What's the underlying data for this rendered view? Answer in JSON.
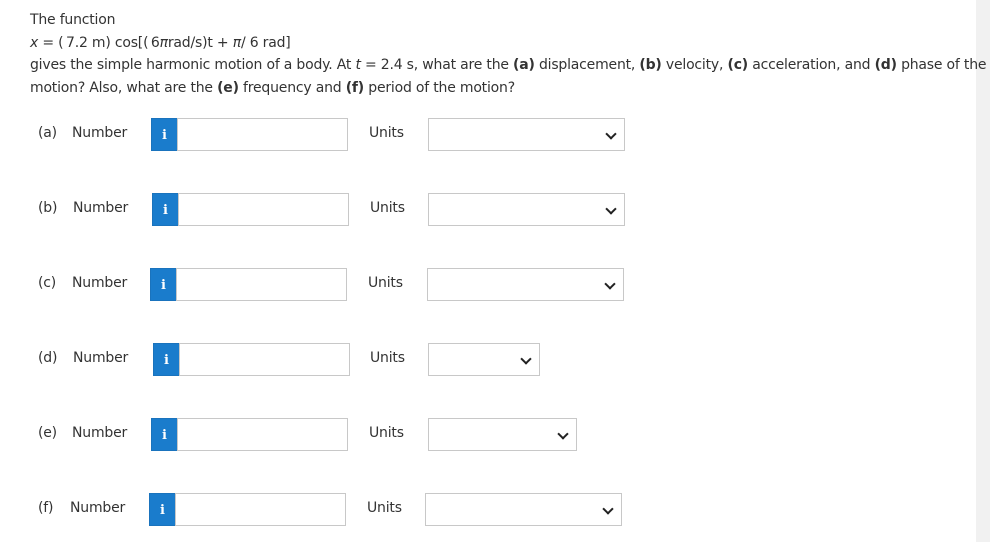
{
  "question": {
    "intro": "The function",
    "equation": {
      "var": "x",
      "eq": " = ( 7.2 m) cos[( 6",
      "pi1": "π",
      "unit": "rad/s)t + ",
      "pi2": "π",
      "tail": "/ 6 rad]"
    },
    "body": {
      "s1": "gives the simple harmonic motion of a body. At ",
      "t_var": "t",
      "s2": " = 2.4 s, what are the ",
      "a": "(a)",
      "a_text": " displacement, ",
      "b": "(b)",
      "b_text": " velocity, ",
      "c": "(c)",
      "c_text": " acceleration, and ",
      "d": "(d)",
      "d_text": " phase of the",
      "line2_start": "motion? Also, what are the ",
      "e": "(e)",
      "e_text": " frequency and ",
      "f": "(f)",
      "f_text": " period of the motion?"
    }
  },
  "answer_rows": [
    {
      "part": "(a)",
      "number_label": "Number",
      "info_icon": "i",
      "value": "",
      "units_label": "Units",
      "units_value": ""
    },
    {
      "part": "(b)",
      "number_label": "Number",
      "info_icon": "i",
      "value": "",
      "units_label": "Units",
      "units_value": ""
    },
    {
      "part": "(c)",
      "number_label": "Number",
      "info_icon": "i",
      "value": "",
      "units_label": "Units",
      "units_value": ""
    },
    {
      "part": "(d)",
      "number_label": "Number",
      "info_icon": "i",
      "value": "",
      "units_label": "Units",
      "units_value": ""
    },
    {
      "part": "(e)",
      "number_label": "Number",
      "info_icon": "i",
      "value": "",
      "units_label": "Units",
      "units_value": ""
    },
    {
      "part": "(f)",
      "number_label": "Number",
      "info_icon": "i",
      "value": "",
      "units_label": "Units",
      "units_value": ""
    }
  ],
  "colors": {
    "info_button": "#1a7ccc",
    "input_border": "#c8c8c8",
    "text": "#333333"
  }
}
